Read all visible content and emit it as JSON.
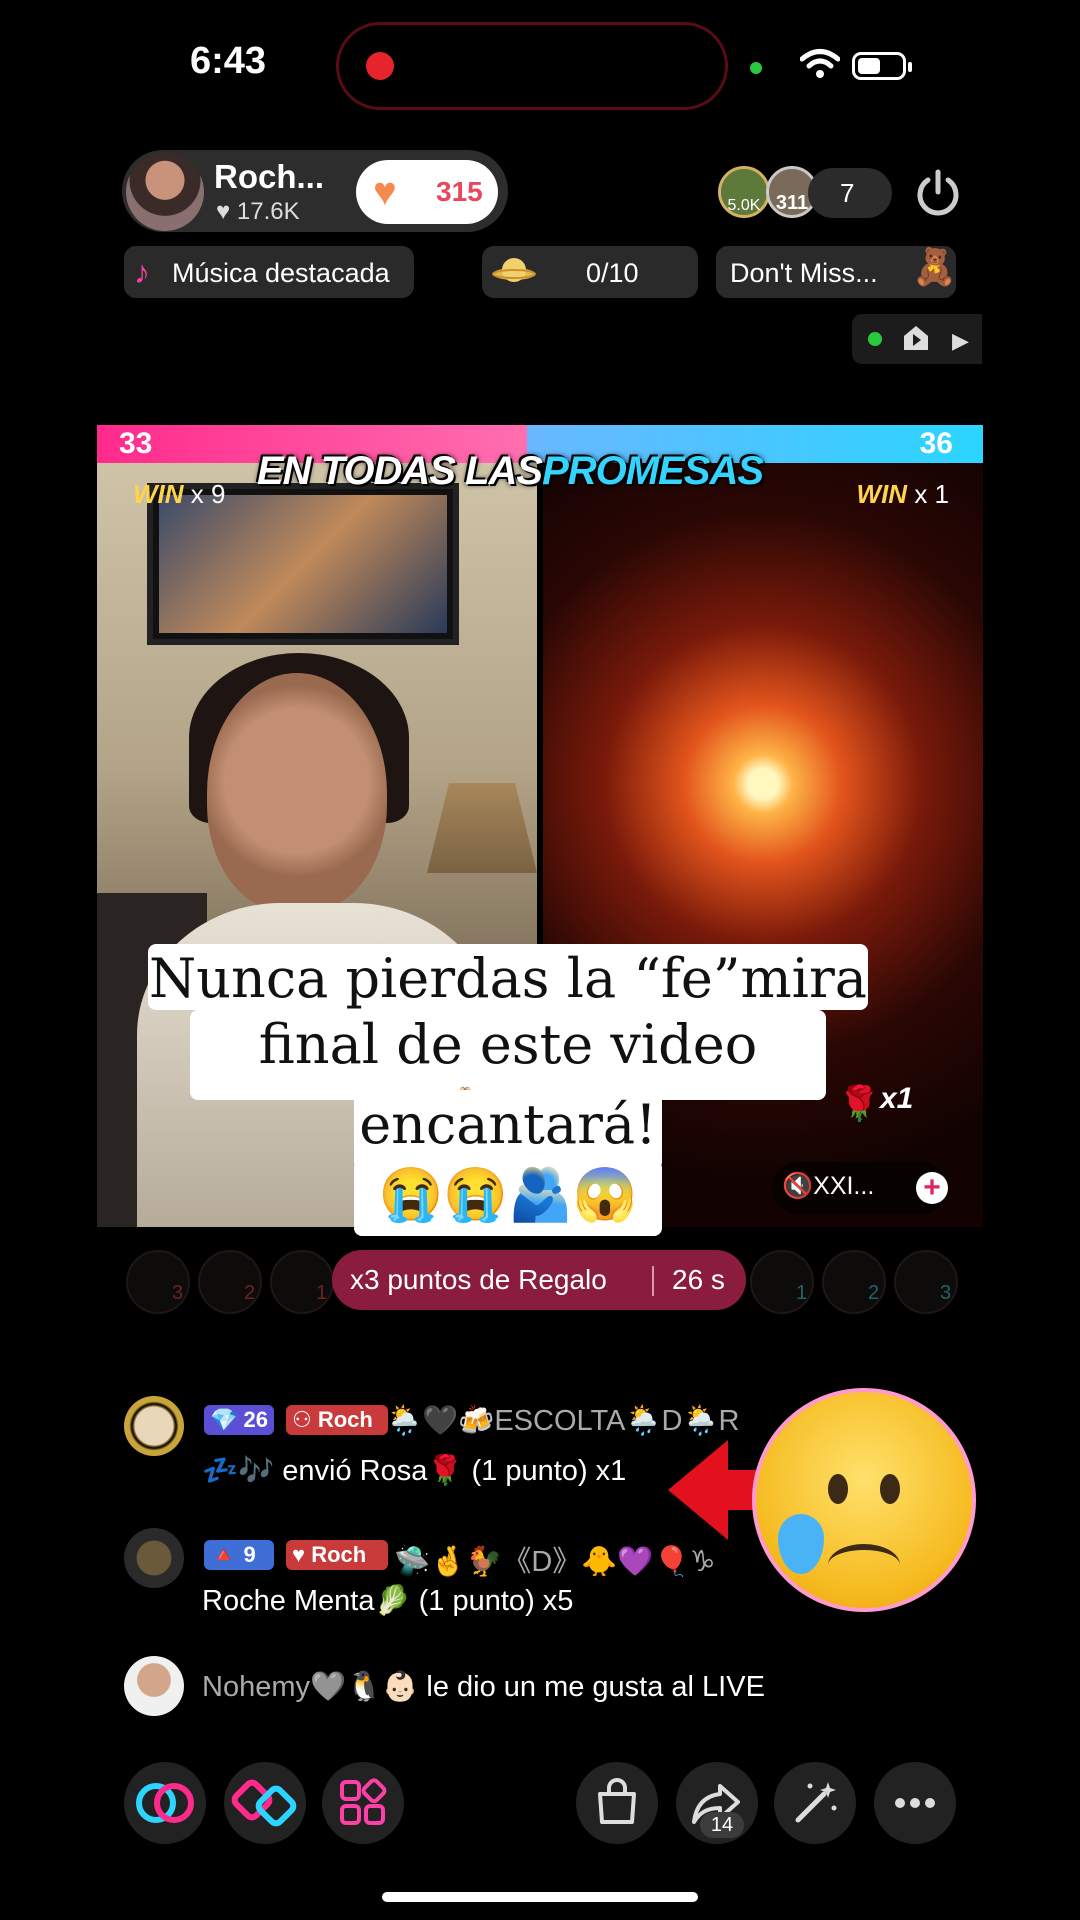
{
  "status_bar": {
    "time": "6:43"
  },
  "host": {
    "name": "Roch...",
    "likes": "♥ 17.6K",
    "heart_count": "315"
  },
  "viewers": {
    "a_label": "5.0K",
    "b_label": "311",
    "count": "7"
  },
  "chips": {
    "music": "Música destacada",
    "planet_progress": "0/10",
    "dont_miss": "Don't Miss..."
  },
  "battle": {
    "score_left": "33",
    "score_right": "36",
    "banner_white": "EN TODAS LAS",
    "banner_blue": "PROMESAS",
    "win_left_word": "WIN",
    "win_left_count": "x 9",
    "win_right_word": "WIN",
    "win_right_count": "x 1",
    "rose_count": "x1",
    "mute_label": "XXI...",
    "plus": "+"
  },
  "caption": {
    "line1": "Nunca pierdas la “fe”mira el",
    "line2": "final de este video 🙏🏻!Te",
    "line3": "encantará!",
    "line4": "😭😭🫂😱"
  },
  "gift_bar": {
    "label": "x3 puntos de Regalo",
    "timer": "26 s",
    "left_ranks": [
      "3",
      "2",
      "1"
    ],
    "right_ranks": [
      "1",
      "2",
      "3"
    ]
  },
  "chat": [
    {
      "level": "💎 26",
      "fan": "Roch",
      "name": "🌦️🖤🍻ESCOLTA🌦️D🌦️R",
      "message": "💤🎶 envió Rosa🌹 (1 punto) x1"
    },
    {
      "level": "🔺 9",
      "fan": "Roch",
      "name": "🛸🤞🐓《D》🐥💜🎈♑",
      "message": "Roche Menta🥬 (1 punto) x5"
    },
    {
      "name": "Nohemy🩶🐧👶🏻",
      "message": " le dio un me gusta al LIVE"
    }
  ],
  "toolbar": {
    "share_count": "14"
  },
  "icons": [
    "record-dot",
    "wifi-icon",
    "battery-icon",
    "heart-icon",
    "power-icon",
    "music-note-icon",
    "planet-icon",
    "bear-icon",
    "home-icon",
    "play-icon",
    "rose-icon",
    "mute-icon",
    "plus-icon",
    "arrow-icon",
    "sad-emoji-icon",
    "link-icon",
    "versus-icon",
    "apps-icon",
    "bag-icon",
    "share-icon",
    "magic-wand-icon",
    "more-icon"
  ],
  "colors": {
    "accent_pink": "#ff2a8c",
    "accent_blue": "#2bd5ff",
    "heart": "#f58a4e",
    "gift_pill": "#8a1c3e"
  }
}
